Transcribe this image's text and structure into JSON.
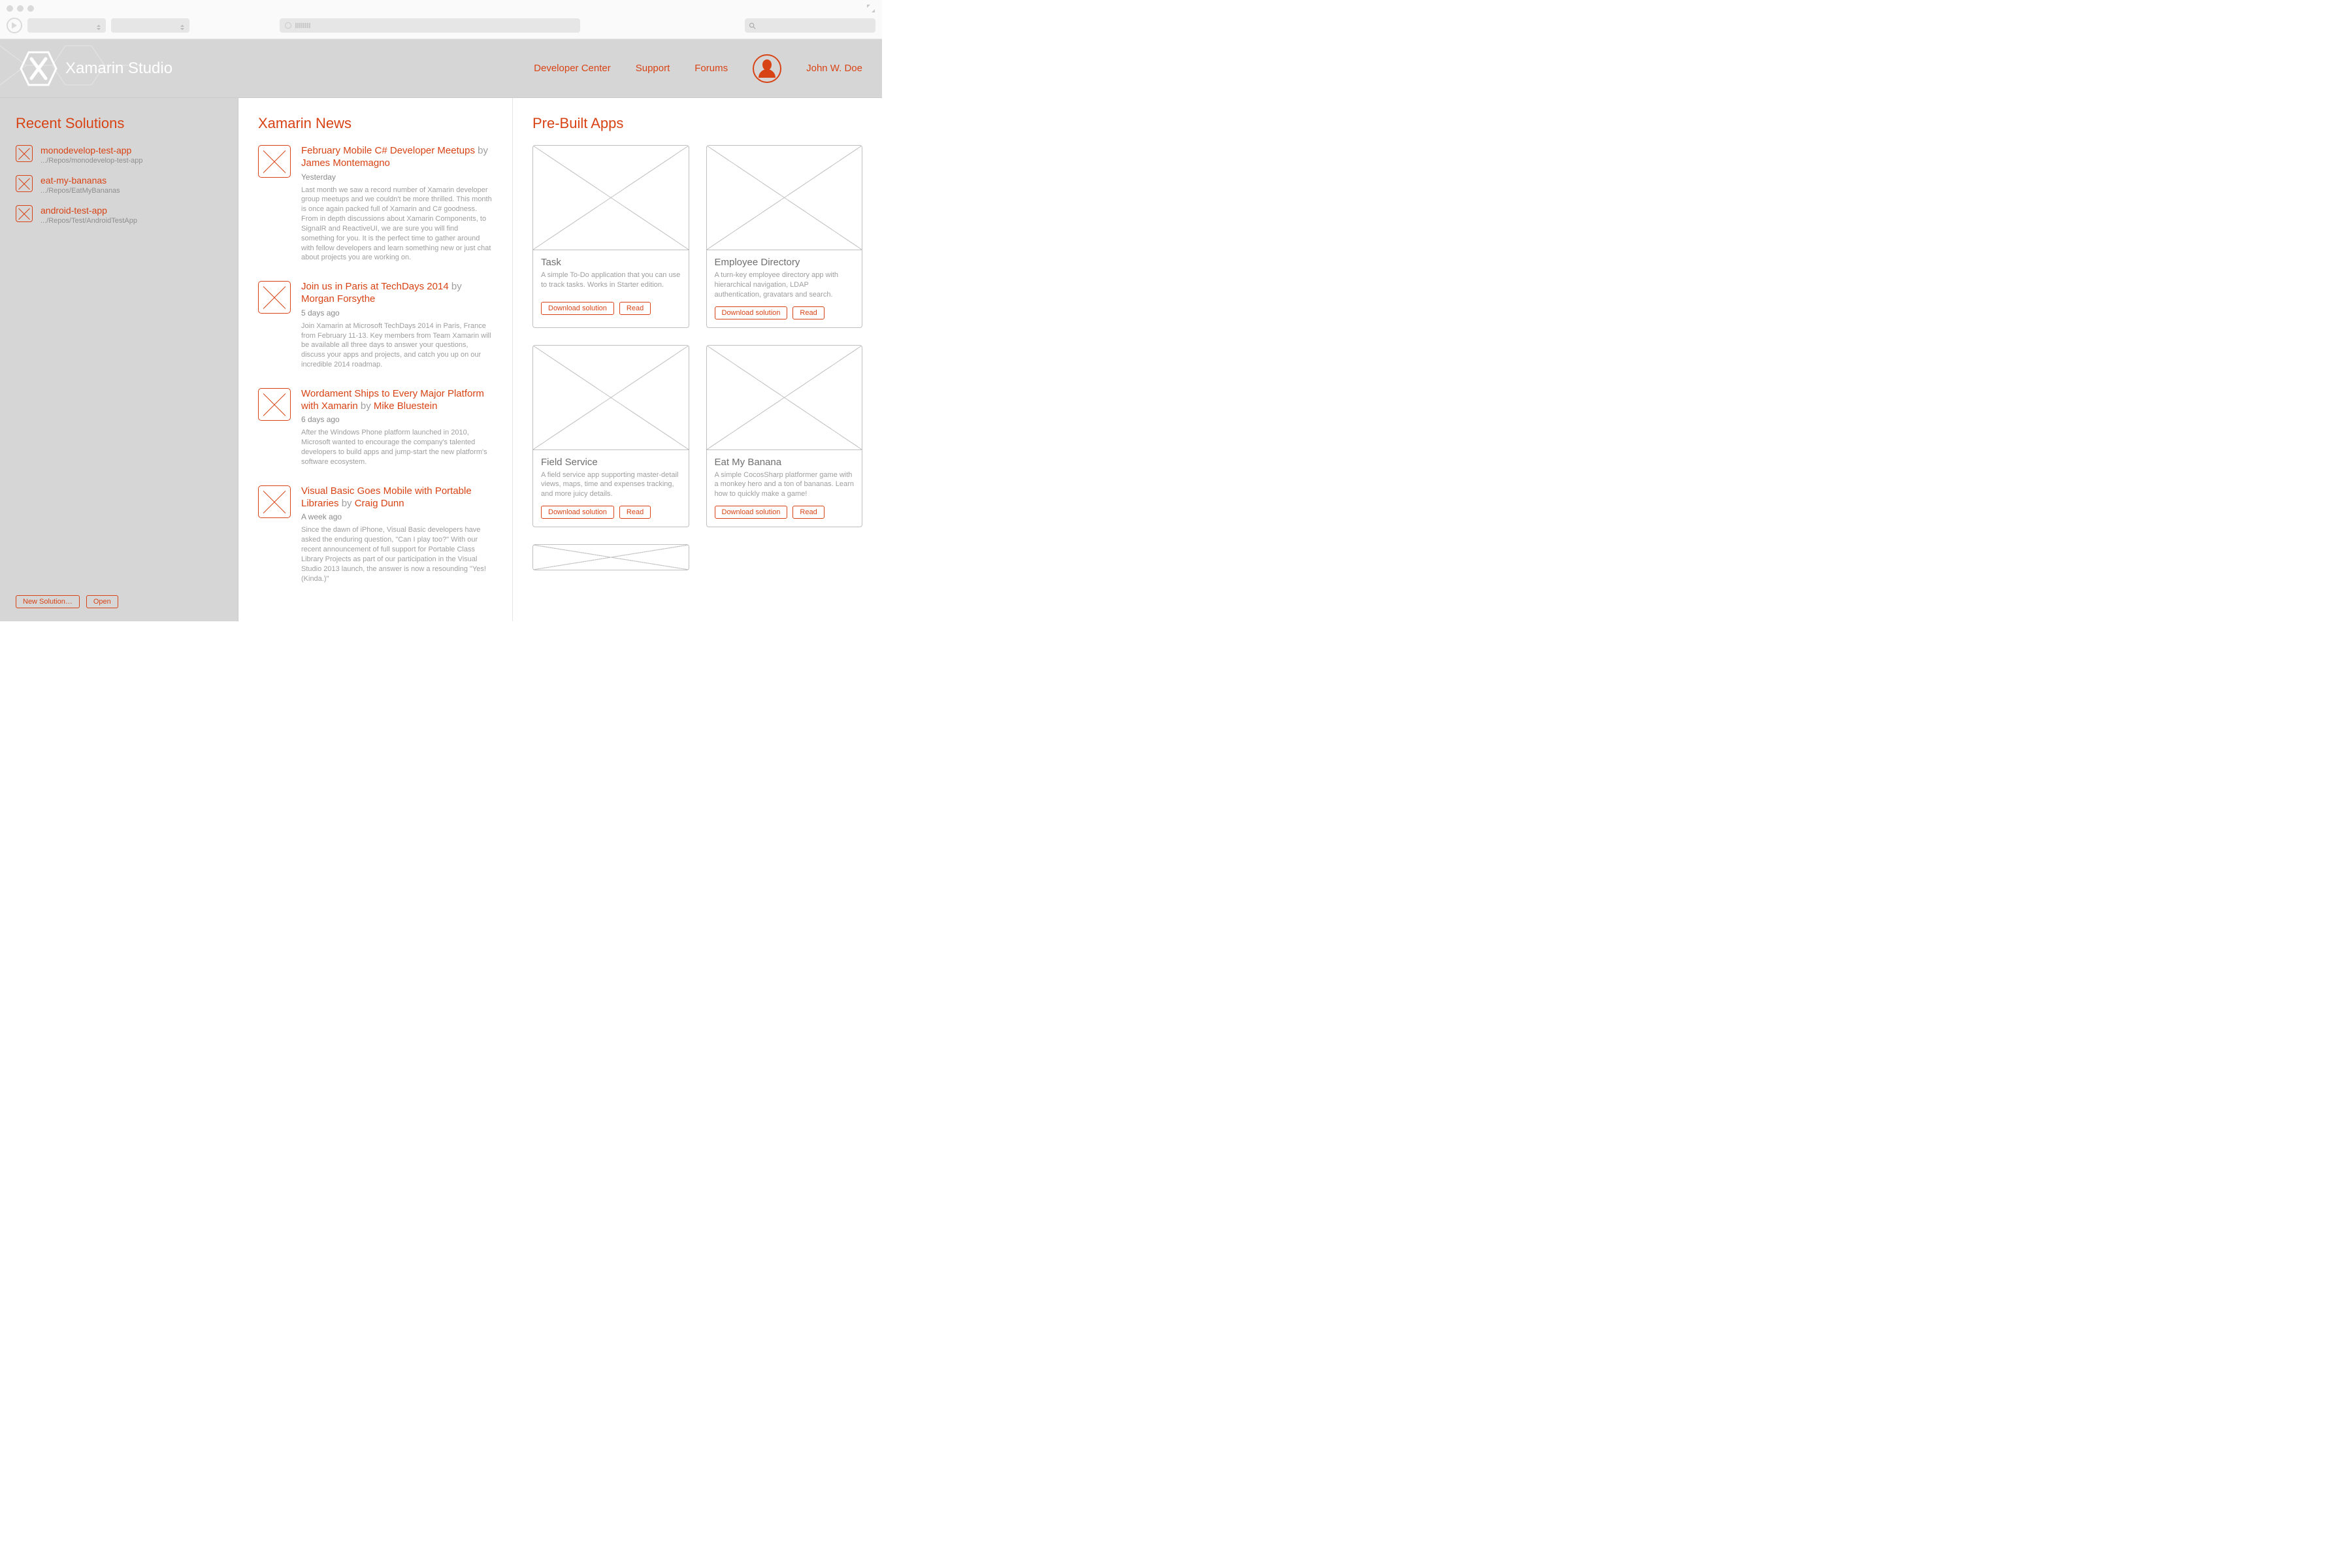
{
  "app": {
    "title": "Xamarin Studio"
  },
  "header": {
    "nav": [
      "Developer Center",
      "Support",
      "Forums"
    ],
    "user": "John W. Doe"
  },
  "sidebar": {
    "title": "Recent Solutions",
    "items": [
      {
        "name": "monodevelop-test-app",
        "path": ".../Repos/monodevelop-test-app"
      },
      {
        "name": "eat-my-bananas",
        "path": ".../Repos/EatMyBananas"
      },
      {
        "name": "android-test-app",
        "path": ".../Repos/Test/AndroidTestApp"
      }
    ],
    "buttons": {
      "new": "New Solution…",
      "open": "Open"
    }
  },
  "news": {
    "title": "Xamarin News",
    "by_label": "by",
    "items": [
      {
        "title": "February Mobile C# Developer Meetups",
        "author": "James Montemagno",
        "date": "Yesterday",
        "excerpt": "Last month we saw a record number of Xamarin developer group meetups and we couldn't be more thrilled. This month is once again packed full of Xamarin and C# goodness. From in depth discussions about Xamarin Components, to SignalR and ReactiveUI, we are sure you will find something for you. It is the perfect time to gather around with fellow developers and learn something new or just chat about projects you are working on."
      },
      {
        "title": "Join us in Paris at TechDays 2014",
        "author": "Morgan Forsythe",
        "date": "5 days ago",
        "excerpt": "Join Xamarin at Microsoft TechDays 2014 in Paris, France from February 11-13.  Key members from Team Xamarin will be available all three days to answer your questions, discuss your apps and projects, and catch you up on our incredible 2014 roadmap."
      },
      {
        "title": "Wordament Ships to Every Major Platform with Xamarin",
        "author": "Mike Bluestein",
        "date": "6 days ago",
        "excerpt": "After the Windows Phone platform launched in 2010, Microsoft wanted to encourage the company's talented developers to build apps and jump-start the new platform's software ecosystem."
      },
      {
        "title": "Visual Basic Goes Mobile with Portable Libraries",
        "author": "Craig Dunn",
        "date": "A week ago",
        "excerpt": "Since the dawn of iPhone, Visual Basic developers have asked the enduring question, \"Can I play too?\" With our recent announcement of full support for Portable Class Library Projects as part of our participation in the Visual Studio 2013 launch, the answer is now a resounding \"Yes! (Kinda.)\""
      }
    ]
  },
  "apps": {
    "title": "Pre-Built Apps",
    "buttons": {
      "download": "Download solution",
      "read": "Read"
    },
    "items": [
      {
        "name": "Task",
        "desc": "A simple To-Do application that you can use to track tasks. Works in Starter edition."
      },
      {
        "name": "Employee Directory",
        "desc": "A turn-key employee directory app with hierarchical navigation, LDAP authentication, gravatars and search."
      },
      {
        "name": "Field Service",
        "desc": "A field service app supporting master-detail views, maps, time and expenses tracking, and more juicy details."
      },
      {
        "name": "Eat My Banana",
        "desc": "A simple CocosSharp platformer game with a monkey hero and a ton of bananas. Learn how to quickly make a game!"
      }
    ]
  }
}
